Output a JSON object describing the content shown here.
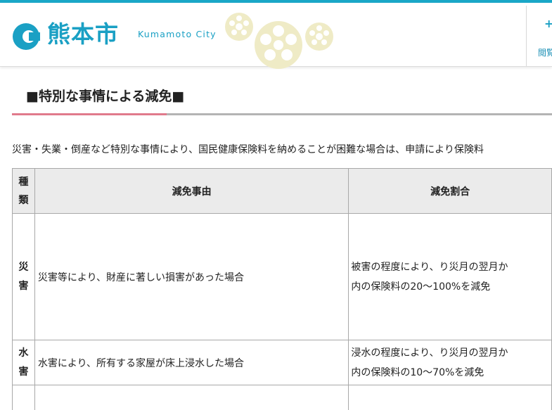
{
  "header": {
    "logo": {
      "kanji": "熊本市",
      "roman": "Kumamoto City"
    },
    "utility": {
      "label": "閲覧"
    },
    "colors": {
      "brand": "#1aa0c4",
      "topbar": "#1aa7c7",
      "decoration": "#efebc6"
    }
  },
  "section": {
    "title": "■特別な事情による減免■",
    "intro": "災害・失業・倒産など特別な事情により、国民健康保険料を納めることが困難な場合は、申請により保険料"
  },
  "table": {
    "headers": {
      "type": [
        "種",
        "類"
      ],
      "reason": "減免事由",
      "rate": "減免割合"
    },
    "rows": [
      {
        "type": [
          "災",
          "害"
        ],
        "reason": "災害等により、財産に著しい損害があった場合",
        "rate": [
          "被害の程度により、り災月の翌月か",
          "内の保険料の20～100%を減免"
        ]
      },
      {
        "type": [
          "水",
          "害"
        ],
        "reason": "水害により、所有する家屋が床上浸水した場合",
        "rate": [
          "浸水の程度により、り災月の翌月か",
          "内の保険料の10～70%を減免"
        ]
      },
      {
        "type": [
          "",
          ""
        ],
        "reason": "",
        "rate": [
          "",
          ""
        ]
      }
    ]
  }
}
